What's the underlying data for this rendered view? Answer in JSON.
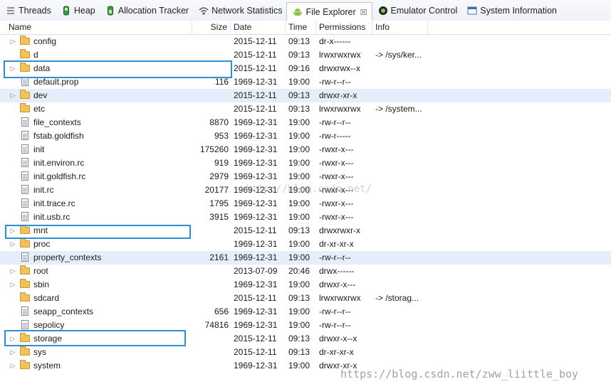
{
  "tabs": [
    {
      "label": "Threads",
      "icon": "threads-icon",
      "active": false
    },
    {
      "label": "Heap",
      "icon": "heap-icon",
      "active": false
    },
    {
      "label": "Allocation Tracker",
      "icon": "allocation-icon",
      "active": false
    },
    {
      "label": "Network Statistics",
      "icon": "network-icon",
      "active": false
    },
    {
      "label": "File Explorer",
      "icon": "android-icon",
      "active": true,
      "close": "☒"
    },
    {
      "label": "Emulator Control",
      "icon": "emulator-icon",
      "active": false
    },
    {
      "label": "System Information",
      "icon": "window-icon",
      "active": false
    }
  ],
  "columns": {
    "name": "Name",
    "size": "Size",
    "date": "Date",
    "time": "Time",
    "permissions": "Permissions",
    "info": "Info"
  },
  "rows": [
    {
      "name": "config",
      "size": "",
      "date": "2015-12-11",
      "time": "09:13",
      "perm": "dr-x------",
      "info": "",
      "type": "folder",
      "expandable": true
    },
    {
      "name": "d",
      "size": "",
      "date": "2015-12-11",
      "time": "09:13",
      "perm": "lrwxrwxrwx",
      "info": "-> /sys/ker...",
      "type": "folder",
      "expandable": false
    },
    {
      "name": "data",
      "size": "",
      "date": "2015-12-11",
      "time": "09:16",
      "perm": "drwxrwx--x",
      "info": "",
      "type": "folder",
      "expandable": true
    },
    {
      "name": "default.prop",
      "size": "116",
      "date": "1969-12-31",
      "time": "19:00",
      "perm": "-rw-r--r--",
      "info": "",
      "type": "file",
      "expandable": false
    },
    {
      "name": "dev",
      "size": "",
      "date": "2015-12-11",
      "time": "09:13",
      "perm": "drwxr-xr-x",
      "info": "",
      "type": "folder",
      "expandable": true
    },
    {
      "name": "etc",
      "size": "",
      "date": "2015-12-11",
      "time": "09:13",
      "perm": "lrwxrwxrwx",
      "info": "-> /system...",
      "type": "folder",
      "expandable": false
    },
    {
      "name": "file_contexts",
      "size": "8870",
      "date": "1969-12-31",
      "time": "19:00",
      "perm": "-rw-r--r--",
      "info": "",
      "type": "file",
      "expandable": false
    },
    {
      "name": "fstab.goldfish",
      "size": "953",
      "date": "1969-12-31",
      "time": "19:00",
      "perm": "-rw-r-----",
      "info": "",
      "type": "file",
      "expandable": false
    },
    {
      "name": "init",
      "size": "175260",
      "date": "1969-12-31",
      "time": "19:00",
      "perm": "-rwxr-x---",
      "info": "",
      "type": "file",
      "expandable": false
    },
    {
      "name": "init.environ.rc",
      "size": "919",
      "date": "1969-12-31",
      "time": "19:00",
      "perm": "-rwxr-x---",
      "info": "",
      "type": "file",
      "expandable": false
    },
    {
      "name": "init.goldfish.rc",
      "size": "2979",
      "date": "1969-12-31",
      "time": "19:00",
      "perm": "-rwxr-x---",
      "info": "",
      "type": "file",
      "expandable": false
    },
    {
      "name": "init.rc",
      "size": "20177",
      "date": "1969-12-31",
      "time": "19:00",
      "perm": "-rwxr-x---",
      "info": "",
      "type": "file",
      "expandable": false
    },
    {
      "name": "init.trace.rc",
      "size": "1795",
      "date": "1969-12-31",
      "time": "19:00",
      "perm": "-rwxr-x---",
      "info": "",
      "type": "file",
      "expandable": false
    },
    {
      "name": "init.usb.rc",
      "size": "3915",
      "date": "1969-12-31",
      "time": "19:00",
      "perm": "-rwxr-x---",
      "info": "",
      "type": "file",
      "expandable": false
    },
    {
      "name": "mnt",
      "size": "",
      "date": "2015-12-11",
      "time": "09:13",
      "perm": "drwxrwxr-x",
      "info": "",
      "type": "folder",
      "expandable": true
    },
    {
      "name": "proc",
      "size": "",
      "date": "1969-12-31",
      "time": "19:00",
      "perm": "dr-xr-xr-x",
      "info": "",
      "type": "folder",
      "expandable": true
    },
    {
      "name": "property_contexts",
      "size": "2161",
      "date": "1969-12-31",
      "time": "19:00",
      "perm": "-rw-r--r--",
      "info": "",
      "type": "file",
      "expandable": false
    },
    {
      "name": "root",
      "size": "",
      "date": "2013-07-09",
      "time": "20:46",
      "perm": "drwx------",
      "info": "",
      "type": "folder",
      "expandable": true
    },
    {
      "name": "sbin",
      "size": "",
      "date": "1969-12-31",
      "time": "19:00",
      "perm": "drwxr-x---",
      "info": "",
      "type": "folder",
      "expandable": true
    },
    {
      "name": "sdcard",
      "size": "",
      "date": "2015-12-11",
      "time": "09:13",
      "perm": "lrwxrwxrwx",
      "info": "-> /storag...",
      "type": "folder",
      "expandable": false
    },
    {
      "name": "seapp_contexts",
      "size": "656",
      "date": "1969-12-31",
      "time": "19:00",
      "perm": "-rw-r--r--",
      "info": "",
      "type": "file",
      "expandable": false
    },
    {
      "name": "sepolicy",
      "size": "74816",
      "date": "1969-12-31",
      "time": "19:00",
      "perm": "-rw-r--r--",
      "info": "",
      "type": "file",
      "expandable": false
    },
    {
      "name": "storage",
      "size": "",
      "date": "2015-12-11",
      "time": "09:13",
      "perm": "drwxr-x--x",
      "info": "",
      "type": "folder",
      "expandable": true
    },
    {
      "name": "sys",
      "size": "",
      "date": "2015-12-11",
      "time": "09:13",
      "perm": "dr-xr-xr-x",
      "info": "",
      "type": "folder",
      "expandable": true
    },
    {
      "name": "system",
      "size": "",
      "date": "1969-12-31",
      "time": "19:00",
      "perm": "drwxr-xr-x",
      "info": "",
      "type": "folder",
      "expandable": true
    }
  ],
  "selected_rows": [
    "dev",
    "property_contexts"
  ],
  "highlighted_rows": [
    "data",
    "mnt",
    "storage"
  ],
  "accent_color": "#2e8fd6",
  "watermark_middle": "http://blog.csdn.net/",
  "watermark_bottom": "https://blog.csdn.net/zww_liittle_boy"
}
